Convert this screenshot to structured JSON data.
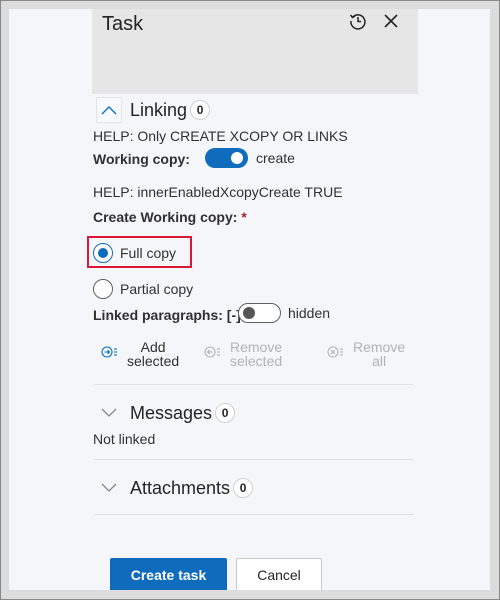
{
  "header": {
    "title": "Task",
    "icons": [
      "history-icon",
      "close-icon"
    ]
  },
  "linking": {
    "label": "Linking",
    "count": "0",
    "expanded": true,
    "help1": "HELP: Only CREATE XCOPY OR LINKS",
    "working_copy_label": "Working copy:",
    "working_copy_toggle": {
      "on": true,
      "text": "create"
    },
    "help2": "HELP: innerEnabledXcopyCreate TRUE",
    "create_working_copy_label": "Create Working copy:",
    "required_mark": "*",
    "options": [
      {
        "label": "Full copy",
        "checked": true
      },
      {
        "label": "Partial copy",
        "checked": false
      }
    ],
    "linked_paragraphs_label": "Linked paragraphs: [-]",
    "linked_paragraphs_toggle": {
      "on": false,
      "text": "hidden"
    },
    "actions": [
      {
        "line1": "Add",
        "line2": "selected",
        "enabled": true,
        "icon": "add-selected-icon"
      },
      {
        "line1": "Remove",
        "line2": "selected",
        "enabled": false,
        "icon": "remove-selected-icon"
      },
      {
        "line1": "Remove",
        "line2": "all",
        "enabled": false,
        "icon": "remove-all-icon"
      }
    ]
  },
  "messages": {
    "label": "Messages",
    "count": "0",
    "status": "Not linked"
  },
  "attachments": {
    "label": "Attachments",
    "count": "0"
  },
  "footer": {
    "create_label": "Create task",
    "cancel_label": "Cancel"
  },
  "colors": {
    "accent": "#0f6cbd",
    "highlight": "#d9183b",
    "required": "#a4262c"
  }
}
